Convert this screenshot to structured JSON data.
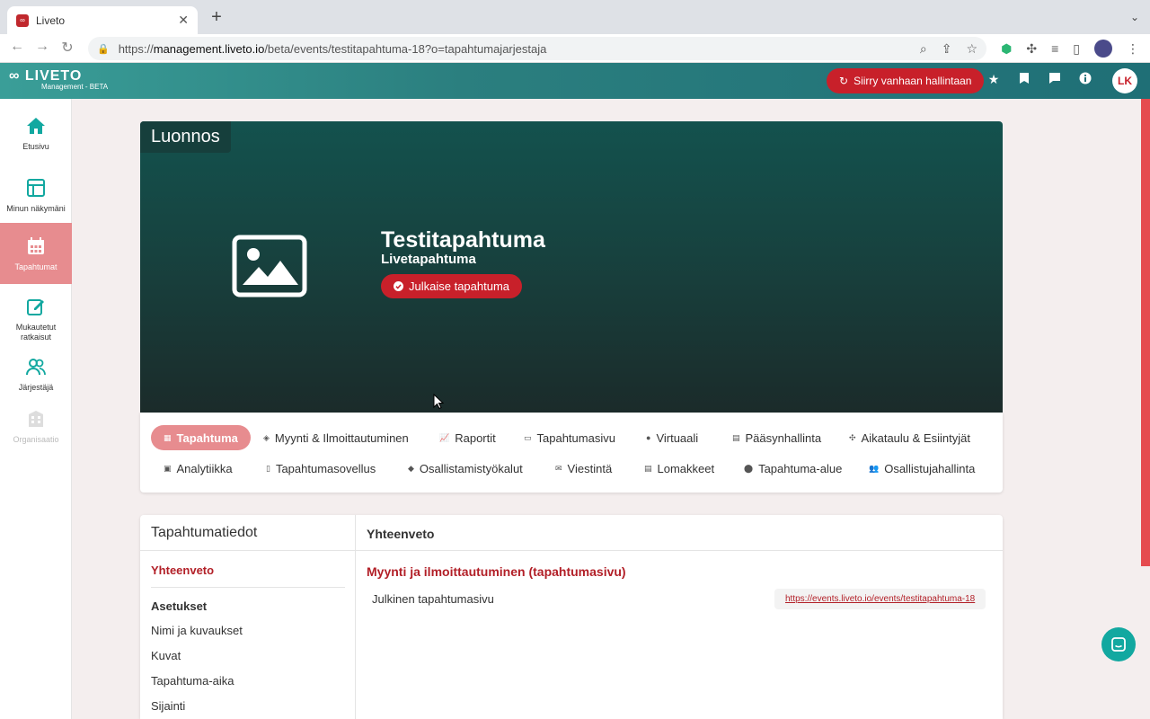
{
  "browser": {
    "tab_title": "Liveto",
    "url_prefix": "https://",
    "url_host": "management.liveto.io",
    "url_path": "/beta/events/testitapahtuma-18?o=tapahtumajarjestaja"
  },
  "header": {
    "logo_text": "LIVETO",
    "logo_sub": "Management - BETA",
    "old_admin_label": "Siirry vanhaan hallintaan",
    "avatar_initials": "LK",
    "accent_color": "#c8202a"
  },
  "sidebar": {
    "items": [
      {
        "label": "Etusivu",
        "icon": "home-icon"
      },
      {
        "label": "Minun näkymäni",
        "icon": "layout-icon"
      },
      {
        "label": "Tapahtumat",
        "icon": "calendar-icon"
      },
      {
        "label": "Mukautetut ratkaisut",
        "icon": "edit-icon"
      },
      {
        "label": "Järjestäjä",
        "icon": "users-icon"
      },
      {
        "label": "Organisaatio",
        "icon": "building-icon"
      }
    ]
  },
  "hero": {
    "status": "Luonnos",
    "event_title": "Testitapahtuma",
    "event_type": "Livetapahtuma",
    "publish_label": "Julkaise tapahtuma"
  },
  "nav": {
    "row1": [
      "Tapahtuma",
      "Myynti & Ilmoittautuminen",
      "Raportit",
      "Tapahtumasivu",
      "Virtuaali",
      "Pääsynhallinta",
      "Aikataulu & Esiintyjät"
    ],
    "row2": [
      "Analytiikka",
      "Tapahtumasovellus",
      "Osallistamistyökalut",
      "Viestintä",
      "Lomakkeet",
      "Tapahtuma-alue",
      "Osallistujahallinta"
    ]
  },
  "details": {
    "panel_title": "Tapahtumatiedot",
    "summary_link": "Yhteenveto",
    "settings_group": "Asetukset",
    "links": [
      "Nimi ja kuvaukset",
      "Kuvat",
      "Tapahtuma-aika",
      "Sijainti"
    ],
    "right_title": "Yhteenveto",
    "section_title": "Myynti ja ilmoittautuminen (tapahtumasivu)",
    "row_label": "Julkinen tapahtumasivu",
    "row_url": "https://events.liveto.io/events/testitapahtuma-18"
  }
}
